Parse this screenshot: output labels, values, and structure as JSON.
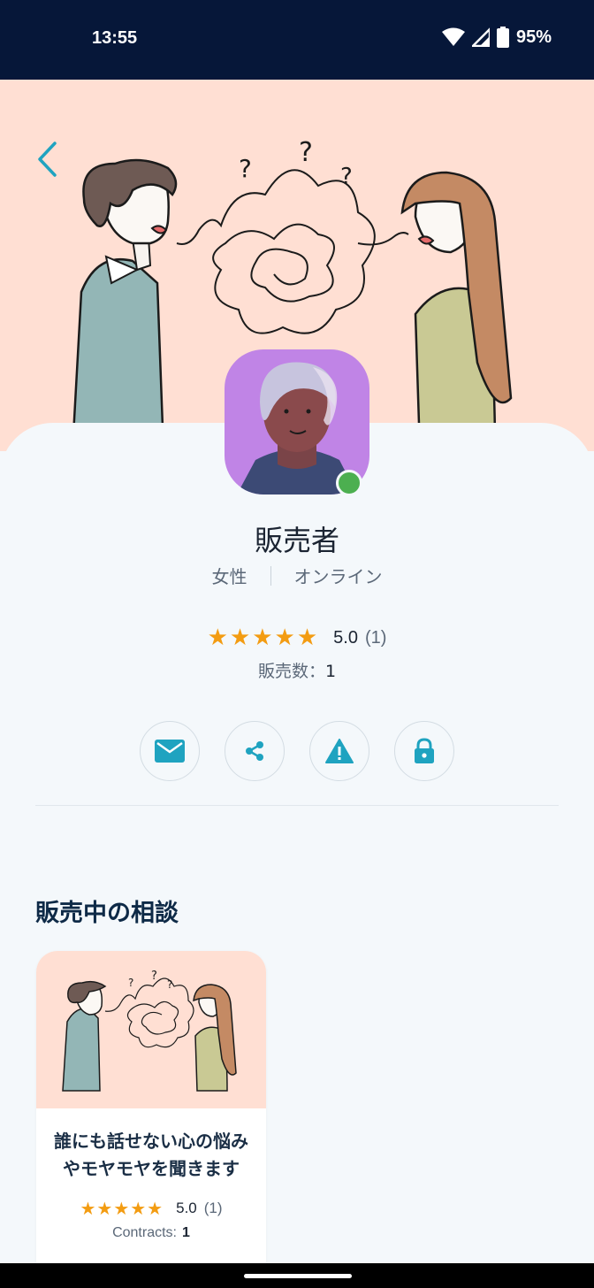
{
  "status_bar": {
    "time": "13:55",
    "battery": "95%"
  },
  "seller": {
    "name": "販売者",
    "gender": "女性",
    "status": "オンライン",
    "rating_value": "5.0",
    "rating_count": "(1)",
    "sales_label": "販売数：",
    "sales_count": "1"
  },
  "actions": [
    {
      "name": "message",
      "icon": "mail-icon"
    },
    {
      "name": "share",
      "icon": "share-icon"
    },
    {
      "name": "report",
      "icon": "warning-icon"
    },
    {
      "name": "block",
      "icon": "lock-icon"
    }
  ],
  "section": {
    "title": "販売中の相談"
  },
  "listing": {
    "title_line1": "誰にも話せない心の悩み",
    "title_line2": "やモヤモヤを聞きます",
    "rating_value": "5.0",
    "rating_count": "(1)",
    "contracts_label": "Contracts:",
    "contracts_count": "1"
  },
  "colors": {
    "accent": "#1fa3c0",
    "status_bar": "#061739",
    "hero_bg": "#ffdfd3",
    "star": "#f39c12",
    "online": "#4caf50"
  }
}
